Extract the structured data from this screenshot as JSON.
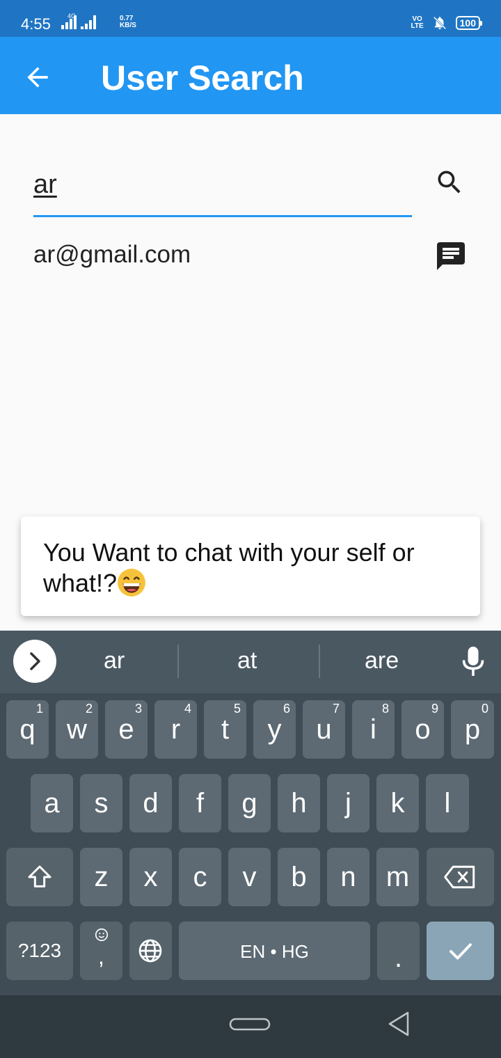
{
  "status_bar": {
    "time": "4:55",
    "network_tag": "4G",
    "speed_value": "0.77",
    "speed_unit": "KB/S",
    "volte_line1": "VO",
    "volte_line2": "LTE",
    "battery": "100"
  },
  "app_bar": {
    "title": "User Search"
  },
  "search": {
    "value": "ar"
  },
  "results": [
    {
      "email": "ar@gmail.com"
    }
  ],
  "snackbar": {
    "message": "You Want to chat with your self or what!?"
  },
  "keyboard": {
    "suggestions": [
      "ar",
      "at",
      "are"
    ],
    "row1": [
      {
        "ch": "q",
        "num": "1"
      },
      {
        "ch": "w",
        "num": "2"
      },
      {
        "ch": "e",
        "num": "3"
      },
      {
        "ch": "r",
        "num": "4"
      },
      {
        "ch": "t",
        "num": "5"
      },
      {
        "ch": "y",
        "num": "6"
      },
      {
        "ch": "u",
        "num": "7"
      },
      {
        "ch": "i",
        "num": "8"
      },
      {
        "ch": "o",
        "num": "9"
      },
      {
        "ch": "p",
        "num": "0"
      }
    ],
    "row2": [
      "a",
      "s",
      "d",
      "f",
      "g",
      "h",
      "j",
      "k",
      "l"
    ],
    "row3": [
      "z",
      "x",
      "c",
      "v",
      "b",
      "n",
      "m"
    ],
    "symbols_label": "?123",
    "comma": ",",
    "space_label": "EN • HG",
    "period": "."
  },
  "colors": {
    "status_bar": "#1f75c4",
    "app_bar": "#2196f3",
    "accent": "#2196f3",
    "keyboard_bg": "#3f4c55",
    "key": "#5d6a73",
    "enter_key": "#8aa6b6"
  }
}
